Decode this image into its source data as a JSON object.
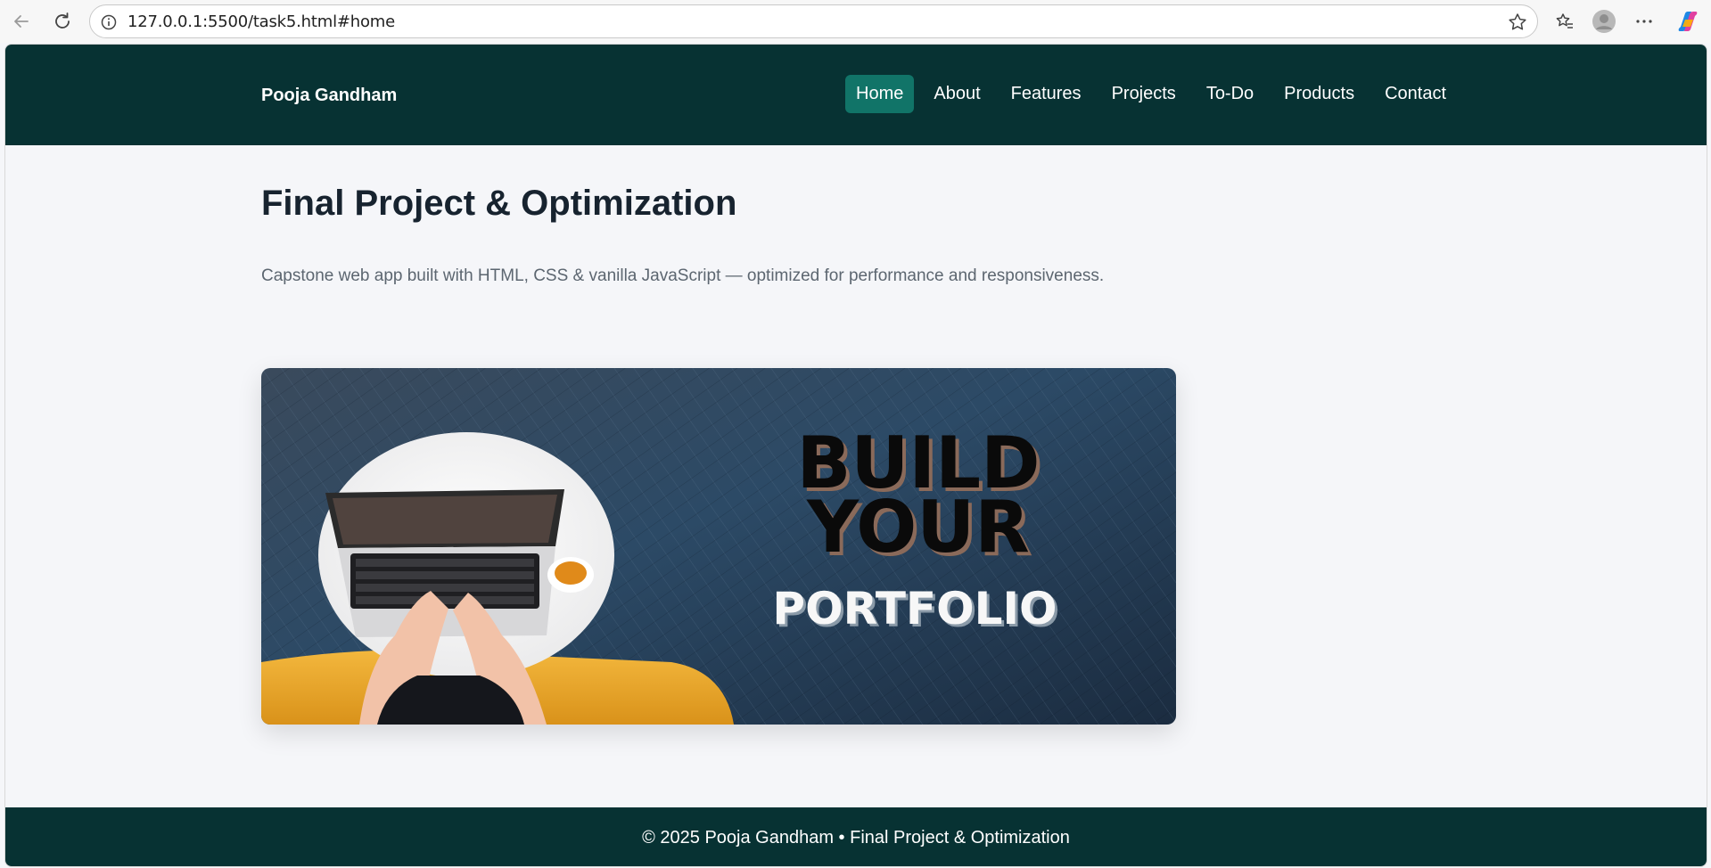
{
  "browser": {
    "url": "127.0.0.1:5500/task5.html#home"
  },
  "header": {
    "brand": "Pooja Gandham",
    "nav": [
      {
        "label": "Home",
        "active": true
      },
      {
        "label": "About",
        "active": false
      },
      {
        "label": "Features",
        "active": false
      },
      {
        "label": "Projects",
        "active": false
      },
      {
        "label": "To-Do",
        "active": false
      },
      {
        "label": "Products",
        "active": false
      },
      {
        "label": "Contact",
        "active": false
      }
    ]
  },
  "main": {
    "title": "Final Project & Optimization",
    "subtitle": "Capstone web app built with HTML, CSS & vanilla JavaScript — optimized for performance and responsiveness.",
    "hero": {
      "line1": "BUILD",
      "line2": "YOUR",
      "line3": "PORTFOLIO"
    }
  },
  "footer": {
    "text": "© 2025 Pooja Gandham • Final Project & Optimization"
  },
  "colors": {
    "header_bg": "#073233",
    "nav_active_bg": "#117468",
    "page_bg": "#f5f6f9",
    "title_color": "#17232f"
  }
}
